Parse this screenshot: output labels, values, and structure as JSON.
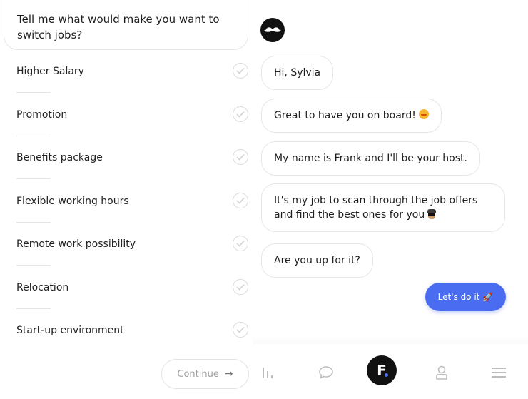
{
  "left": {
    "question": "Tell me what would make you want to switch jobs?",
    "options": [
      "Higher Salary",
      "Promotion",
      "Benefits package",
      "Flexible working hours",
      "Remote work possibility",
      "Relocation",
      "Start-up environment"
    ],
    "continue_label": "Continue",
    "continue_arrow": "→"
  },
  "chat": {
    "avatar_icon": "mustache-icon",
    "messages": [
      "Hi, Sylvia",
      "Great to have you on board!",
      "My name is Frank and I'll be your host.",
      "It's my job to scan through the job offers and find the best ones for you",
      "Are you up for it?"
    ],
    "action_label": "Let's do it",
    "action_emoji": "🚀"
  },
  "nav": {
    "home_letter": "F",
    "items": [
      "stats-icon",
      "chat-icon",
      "home-logo",
      "profile-icon",
      "menu-icon"
    ]
  },
  "colors": {
    "accent": "#4a6cf0",
    "dark": "#111111",
    "border": "#e6e6e6"
  }
}
